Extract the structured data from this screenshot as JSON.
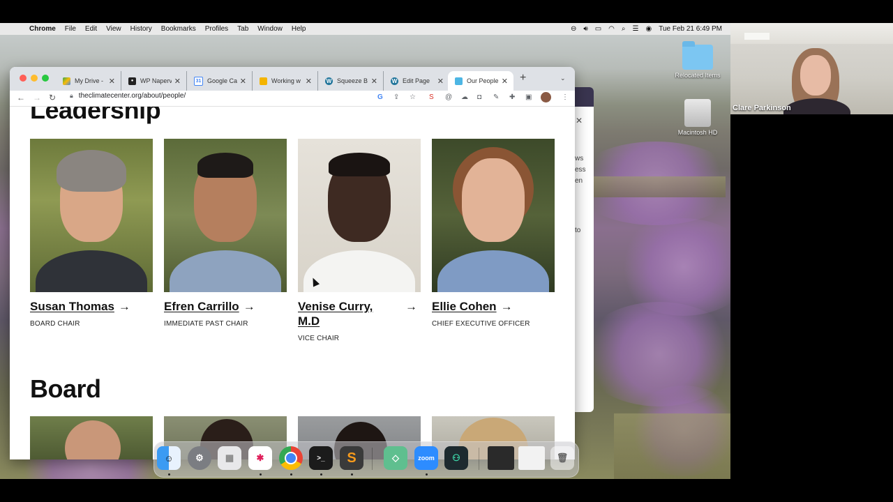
{
  "menubar": {
    "app": "Chrome",
    "items": [
      "File",
      "Edit",
      "View",
      "History",
      "Bookmarks",
      "Profiles",
      "Tab",
      "Window",
      "Help"
    ],
    "datetime": "Tue Feb 21  6:49 PM"
  },
  "desktop": {
    "icons": [
      {
        "label": "Relocated Items",
        "icon": "folder-icon"
      },
      {
        "label": "Macintosh HD",
        "icon": "hard-drive-icon"
      }
    ]
  },
  "browser": {
    "tabs": [
      {
        "title": "My Drive -",
        "favicon": "google-drive-icon"
      },
      {
        "title": "WP Naperv",
        "favicon": "website-icon"
      },
      {
        "title": "Google Cal",
        "favicon": "google-calendar-icon"
      },
      {
        "title": "Working w",
        "favicon": "google-slides-icon"
      },
      {
        "title": "Squeeze B",
        "favicon": "wordpress-icon"
      },
      {
        "title": "Edit Page",
        "favicon": "wordpress-icon"
      },
      {
        "title": "Our People",
        "favicon": "climate-center-icon",
        "active": true
      }
    ],
    "url": "theclimatecenter.org/about/people/"
  },
  "page": {
    "leadership_heading": "Leadership",
    "board_heading": "Board",
    "leadership": [
      {
        "name": "Susan Thomas",
        "role": "BOARD CHAIR"
      },
      {
        "name": "Efren Carrillo",
        "role": "IMMEDIATE PAST CHAIR"
      },
      {
        "name": "Venise Curry, M.D",
        "role": "VICE CHAIR"
      },
      {
        "name": "Ellie Cohen",
        "role": "CHIEF EXECUTIVE OFFICER"
      }
    ],
    "arrow": "→"
  },
  "dock": {
    "apps": [
      "Finder",
      "System Preferences",
      "Launchpad",
      "Slack",
      "Chrome",
      "Terminal",
      "Sublime Text",
      "Pluto",
      "Zoom",
      "GitKraken"
    ],
    "zoom_label": "zoom"
  },
  "webcam": {
    "participant": "Clare Parkinson"
  },
  "peek": {
    "lines": [
      "ws",
      "ess",
      "en",
      "to"
    ]
  }
}
